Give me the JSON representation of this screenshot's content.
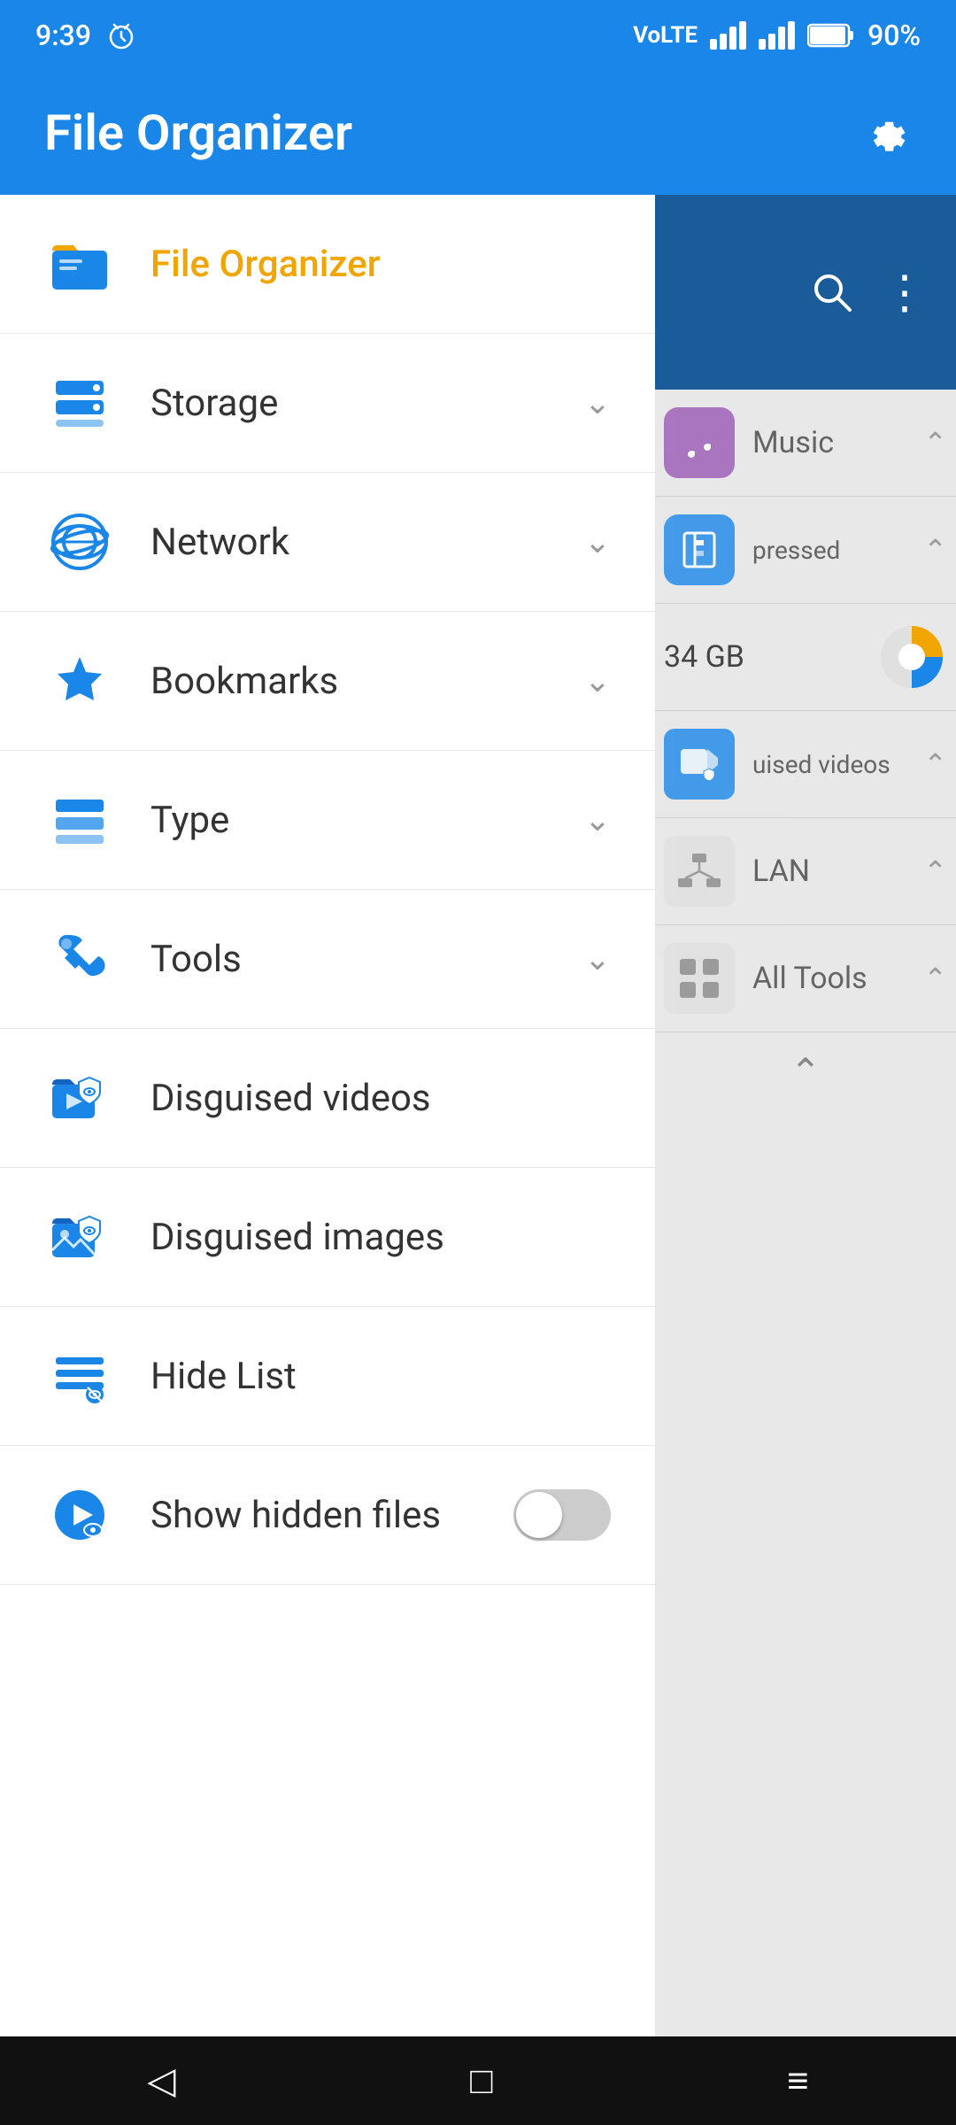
{
  "status": {
    "time": "9:39",
    "battery": "90%",
    "battery_level": 90
  },
  "header": {
    "title": "File Organizer",
    "gear_label": "⚙"
  },
  "sidebar": {
    "items": [
      {
        "id": "file-organizer",
        "label": "File Organizer",
        "active": true,
        "has_chevron": false,
        "icon": "folder"
      },
      {
        "id": "storage",
        "label": "Storage",
        "active": false,
        "has_chevron": true,
        "icon": "storage"
      },
      {
        "id": "network",
        "label": "Network",
        "active": false,
        "has_chevron": true,
        "icon": "network"
      },
      {
        "id": "bookmarks",
        "label": "Bookmarks",
        "active": false,
        "has_chevron": true,
        "icon": "bookmark"
      },
      {
        "id": "type",
        "label": "Type",
        "active": false,
        "has_chevron": true,
        "icon": "type"
      },
      {
        "id": "tools",
        "label": "Tools",
        "active": false,
        "has_chevron": true,
        "icon": "tools"
      },
      {
        "id": "disguised-videos",
        "label": "Disguised videos",
        "active": false,
        "has_chevron": false,
        "icon": "disguised-video"
      },
      {
        "id": "disguised-images",
        "label": "Disguised images",
        "active": false,
        "has_chevron": false,
        "icon": "disguised-image"
      },
      {
        "id": "hide-list",
        "label": "Hide List",
        "active": false,
        "has_chevron": false,
        "icon": "hide-list"
      }
    ],
    "toggle_item": {
      "label": "Show hidden files",
      "enabled": false
    }
  },
  "right_panel": {
    "music_label": "Music",
    "compressed_label": "pressed",
    "disk_label": "34 GB",
    "lan_label": "LAN",
    "all_tools_label": "All Tools",
    "disguised_videos_label": "uised videos"
  },
  "bottom_nav": {
    "back": "◁",
    "home": "□",
    "menu": "≡"
  }
}
